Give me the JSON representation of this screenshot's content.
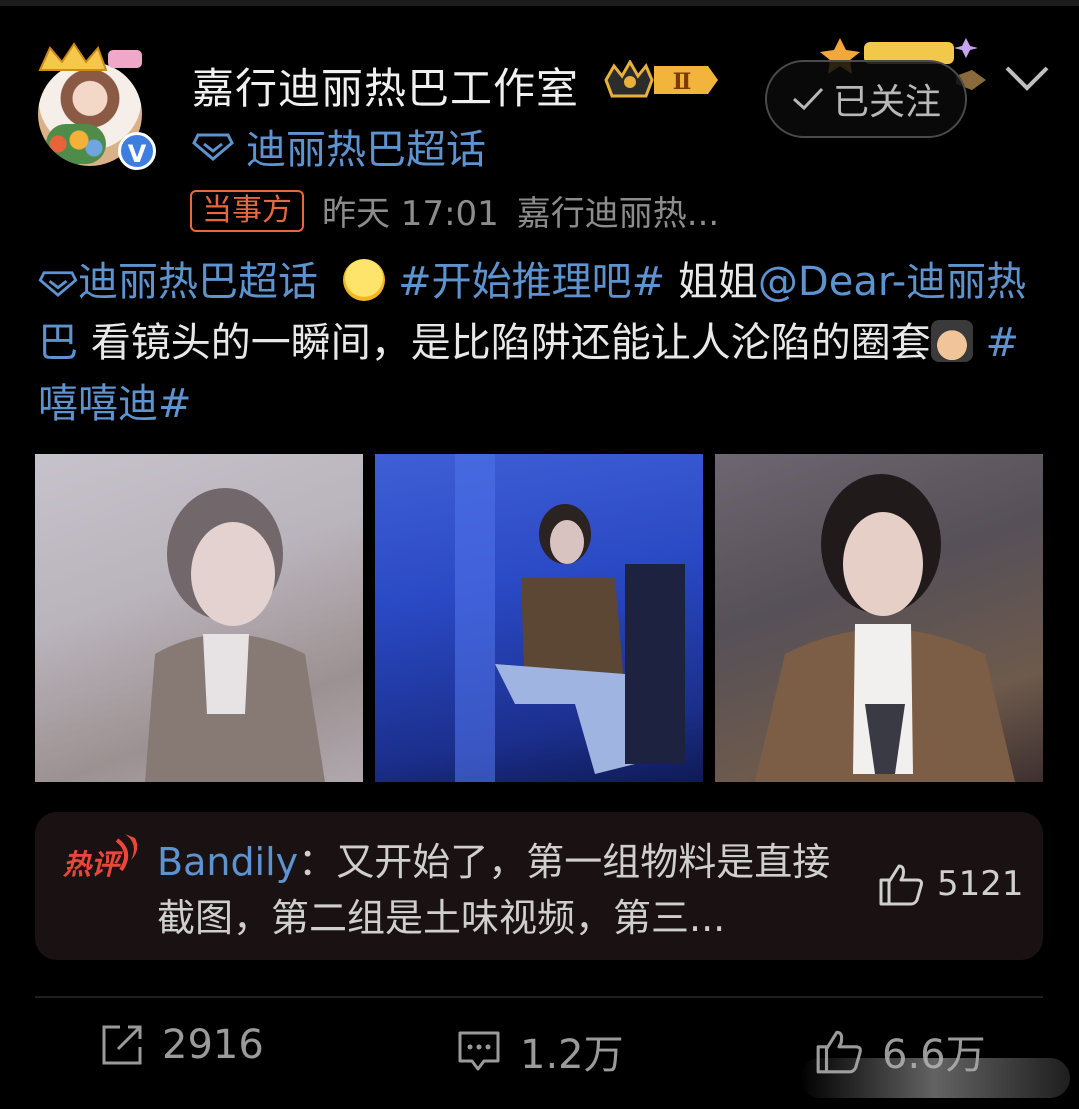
{
  "post": {
    "author": "嘉行迪丽热巴工作室",
    "level": "Ⅱ",
    "supertopic": "迪丽热巴超话",
    "follow_label": "已关注",
    "party_tag": "当事方",
    "time": "昨天 17:01",
    "source": "嘉行迪丽热..."
  },
  "content": {
    "supertopic_link": "迪丽热巴超话",
    "hashtag1": "#开始推理吧#",
    "text1": "姐姐",
    "mention": "@Dear-迪丽热巴",
    "text2": "看镜头的一瞬间，是比陷阱还能让人沦陷的圈套",
    "hashtag2": "#嘻嘻迪#"
  },
  "hot_comment": {
    "badge": "热评",
    "name": "Bandily",
    "separator": "：",
    "text": "又开始了，第一组物料是直接截图，第二组是土味视频，第三...",
    "likes": "5121"
  },
  "actions": {
    "reposts": "2916",
    "comments": "1.2万",
    "likes": "6.6万"
  },
  "colors": {
    "background": "#000000",
    "link": "#5d93cf",
    "party_tag": "#e6683c",
    "verified": "#3e7ee0"
  },
  "icons": [
    "crown-icon",
    "verified-icon",
    "supertopic-diamond-icon",
    "check-icon",
    "chevron-down-icon",
    "repost-icon",
    "comment-icon",
    "like-icon"
  ]
}
